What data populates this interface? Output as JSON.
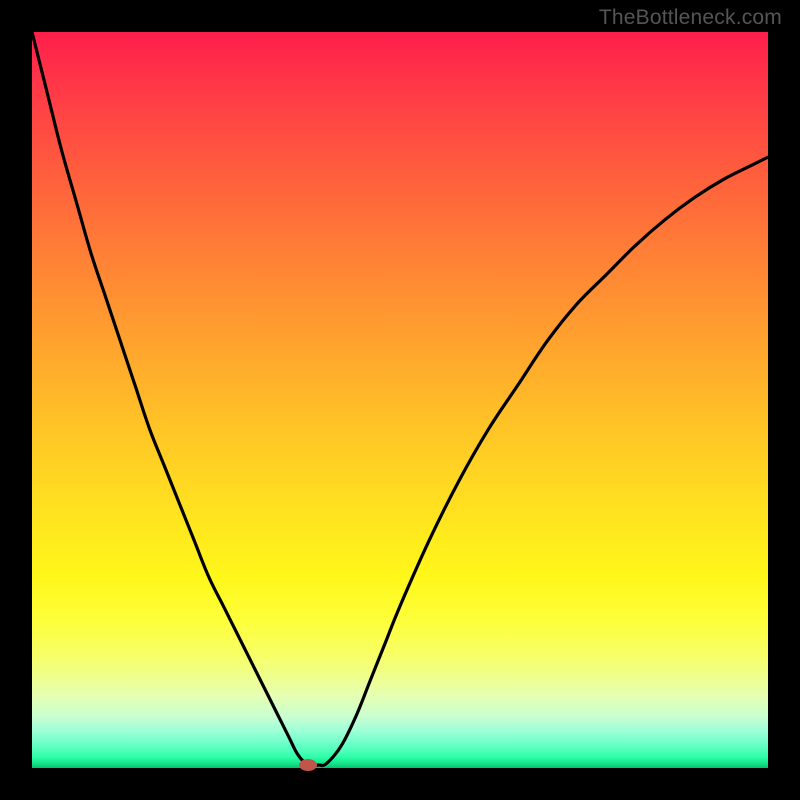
{
  "watermark": "TheBottleneck.com",
  "chart_data": {
    "type": "line",
    "title": "",
    "xlabel": "",
    "ylabel": "",
    "xlim": [
      0,
      100
    ],
    "ylim": [
      0,
      100
    ],
    "grid": false,
    "legend": false,
    "series": [
      {
        "name": "curve",
        "x": [
          0,
          2,
          4,
          6,
          8,
          10,
          12,
          14,
          16,
          18,
          20,
          22,
          24,
          26,
          28,
          30,
          32,
          33,
          34,
          35,
          36,
          37,
          38,
          39,
          40,
          42,
          44,
          46,
          48,
          50,
          54,
          58,
          62,
          66,
          70,
          74,
          78,
          82,
          86,
          90,
          94,
          98,
          100
        ],
        "y": [
          100,
          92,
          84,
          77,
          70,
          64,
          58,
          52,
          46,
          41,
          36,
          31,
          26,
          22,
          18,
          14,
          10,
          8,
          6,
          4,
          2,
          0.8,
          0.4,
          0.4,
          0.6,
          3,
          7,
          12,
          17,
          22,
          31,
          39,
          46,
          52,
          58,
          63,
          67,
          71,
          74.5,
          77.5,
          80,
          82,
          83
        ]
      }
    ],
    "marker": {
      "x": 37.5,
      "y": 0.4,
      "color": "#c0564b"
    },
    "background_gradient": {
      "top": "#ff1e4b",
      "mid": "#fff71a",
      "bottom": "#0bbf6b"
    }
  }
}
